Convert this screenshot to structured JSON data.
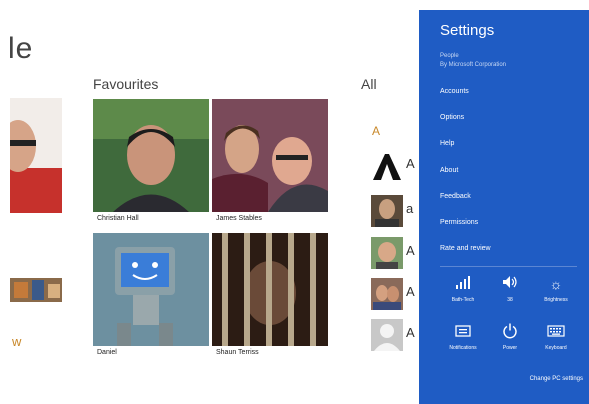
{
  "app": {
    "title_fragment": "le",
    "left_letter": "w",
    "favourites_title": "Favourites",
    "all_title": "All",
    "all_letter": "A",
    "favourites": [
      {
        "name": "Christian Hall"
      },
      {
        "name": "James Stables"
      },
      {
        "name": "Daniel"
      },
      {
        "name": "Shaun Terriss"
      }
    ],
    "contacts": [
      {
        "initial": "A"
      },
      {
        "initial": "a"
      },
      {
        "initial": "A"
      },
      {
        "initial": "A"
      },
      {
        "initial": "A"
      }
    ]
  },
  "settings": {
    "title": "Settings",
    "app_name": "People",
    "publisher": "By Microsoft Corporation",
    "menu": [
      "Accounts",
      "Options",
      "Help",
      "About",
      "Feedback",
      "Permissions",
      "Rate and review"
    ],
    "quick": [
      {
        "label": "Bath-Tech",
        "icon": "signal-icon"
      },
      {
        "label": "38",
        "icon": "volume-icon"
      },
      {
        "label": "Brightness",
        "icon": "brightness-icon"
      },
      {
        "label": "Notifications",
        "icon": "notifications-icon"
      },
      {
        "label": "Power",
        "icon": "power-icon"
      },
      {
        "label": "Keyboard",
        "icon": "keyboard-icon"
      }
    ],
    "change_pc_settings": "Change PC settings"
  },
  "colors": {
    "charm_blue": "#1f5cc4",
    "accent_orange": "#c8882a"
  }
}
